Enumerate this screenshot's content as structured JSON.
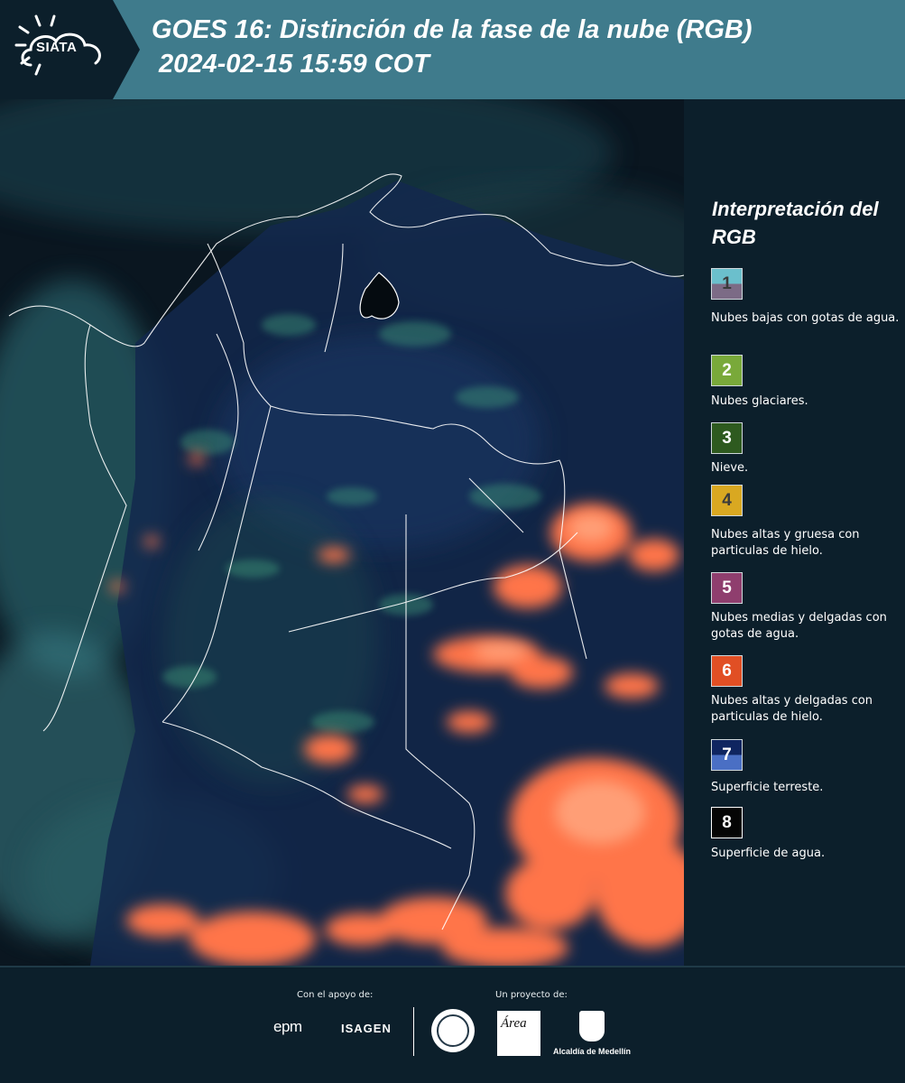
{
  "header": {
    "logo_text": "SIATA",
    "title_line1": "GOES 16: Distinción de la fase de la nube (RGB)",
    "title_line2": " 2024-02-15 15:59 COT"
  },
  "legend": {
    "title": "Interpretación del RGB",
    "items": [
      {
        "number": "1",
        "label": "Nubes bajas con gotas de agua.",
        "color_top": "#6bbfcc",
        "color_bottom": "#7c6b86",
        "text_color": "#3a3a3a"
      },
      {
        "number": "2",
        "label": "Nubes glaciares.",
        "color_top": "#79a93a",
        "color_bottom": "#79a93a",
        "text_color": "#ffffff"
      },
      {
        "number": "3",
        "label": "Nieve.",
        "color_top": "#2e5a1f",
        "color_bottom": "#2e5a1f",
        "text_color": "#ffffff"
      },
      {
        "number": "4",
        "label": "Nubes altas y gruesa con particulas de hielo.",
        "color_top": "#d9a821",
        "color_bottom": "#d9a821",
        "text_color": "#3a3a3a"
      },
      {
        "number": "5",
        "label": "Nubes medias y delgadas con gotas de agua.",
        "color_top": "#8f3e6e",
        "color_bottom": "#8f3e6e",
        "text_color": "#ffffff"
      },
      {
        "number": "6",
        "label": "Nubes altas y delgadas con particulas de hielo.",
        "color_top": "#e14f24",
        "color_bottom": "#e14f24",
        "text_color": "#ffffff"
      },
      {
        "number": "7",
        "label": "Superficie terreste.",
        "color_top": "#0f2560",
        "color_bottom": "#4a6fc4",
        "text_color": "#ffffff"
      },
      {
        "number": "8",
        "label": "Superficie de agua.",
        "color_top": "#050505",
        "color_bottom": "#050505",
        "text_color": "#ffffff"
      }
    ]
  },
  "footer": {
    "support_label": "Con el apoyo de:",
    "project_label": "Un proyecto de:",
    "epm": "epm",
    "isagen": "ISAGEN",
    "area_logo_text": "Área",
    "alcaldia": "Alcaldía de Medellín"
  },
  "colors": {
    "header_bg": "#3f7b8c",
    "panel_bg": "#0c1f2b",
    "ice_cloud": "#ff7a45",
    "water_cloud": "#4f9aa6",
    "land": "#142a52"
  }
}
